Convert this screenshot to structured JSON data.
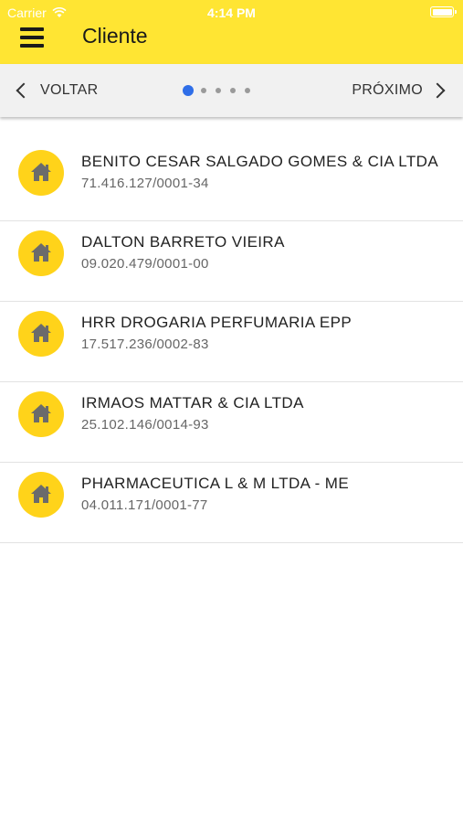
{
  "status_bar": {
    "carrier": "Carrier",
    "time": "4:14 PM"
  },
  "header": {
    "title": "Cliente",
    "background_color": "#ffe533"
  },
  "pager": {
    "back_label": "VOLTAR",
    "next_label": "PRÓXIMO",
    "page_count": 5,
    "current_page": 1,
    "active_dot_color": "#2f6ee8"
  },
  "clients": [
    {
      "name": "BENITO CESAR SALGADO GOMES & CIA LTDA",
      "cnpj": "71.416.127/0001-34",
      "icon": "home-icon"
    },
    {
      "name": "DALTON BARRETO VIEIRA",
      "cnpj": "09.020.479/0001-00",
      "icon": "home-icon"
    },
    {
      "name": "HRR DROGARIA PERFUMARIA EPP",
      "cnpj": "17.517.236/0002-83",
      "icon": "home-icon"
    },
    {
      "name": "IRMAOS MATTAR & CIA LTDA",
      "cnpj": "25.102.146/0014-93",
      "icon": "home-icon"
    },
    {
      "name": "PHARMACEUTICA L & M LTDA - ME",
      "cnpj": "04.011.171/0001-77",
      "icon": "home-icon"
    }
  ],
  "colors": {
    "avatar": "#ffd31a",
    "icon": "#6b6b6b"
  }
}
